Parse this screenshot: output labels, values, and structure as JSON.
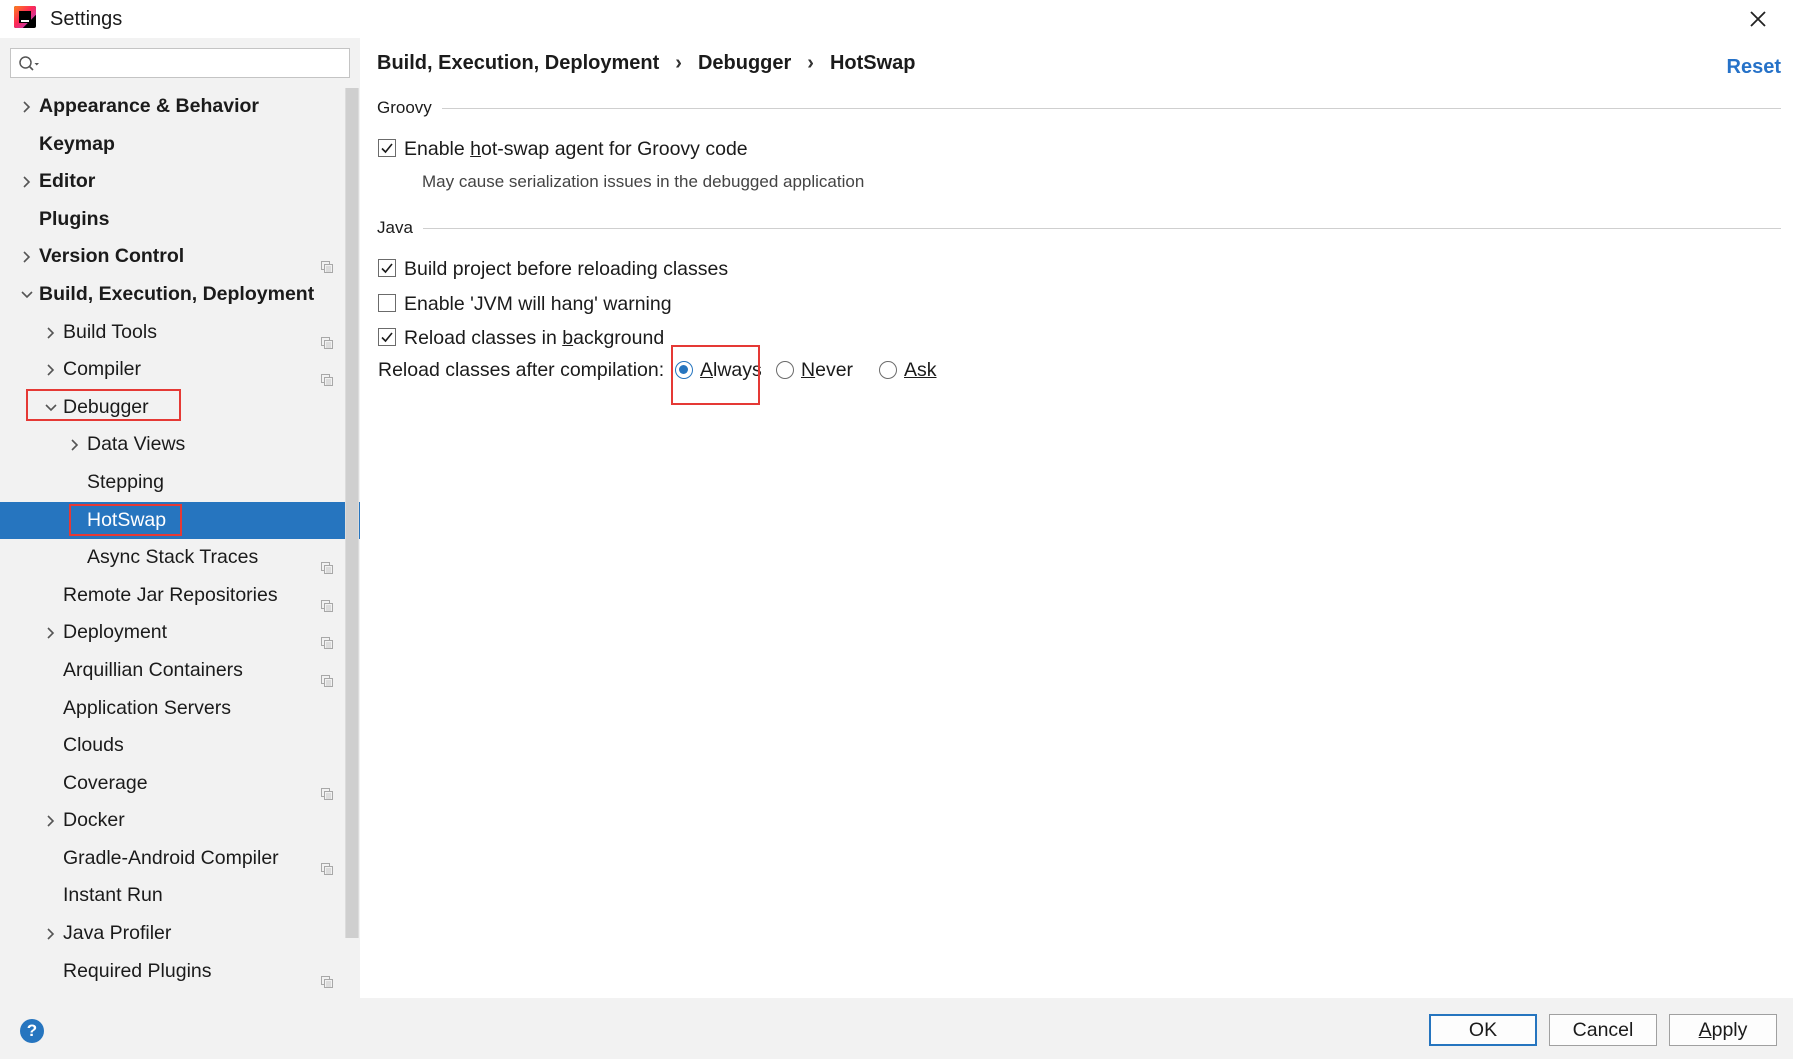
{
  "window": {
    "title": "Settings"
  },
  "search": {
    "placeholder": ""
  },
  "sidebar": {
    "items": [
      {
        "label": "Appearance & Behavior",
        "level": 0,
        "bold": true,
        "chevron": "right",
        "project_icon": false
      },
      {
        "label": "Keymap",
        "level": 0,
        "bold": true,
        "chevron": "none",
        "project_icon": false
      },
      {
        "label": "Editor",
        "level": 0,
        "bold": true,
        "chevron": "right",
        "project_icon": false
      },
      {
        "label": "Plugins",
        "level": 0,
        "bold": true,
        "chevron": "none",
        "project_icon": false
      },
      {
        "label": "Version Control",
        "level": 0,
        "bold": true,
        "chevron": "right",
        "project_icon": true
      },
      {
        "label": "Build, Execution, Deployment",
        "level": 0,
        "bold": true,
        "chevron": "down",
        "project_icon": false
      },
      {
        "label": "Build Tools",
        "level": 1,
        "bold": false,
        "chevron": "right",
        "project_icon": true
      },
      {
        "label": "Compiler",
        "level": 1,
        "bold": false,
        "chevron": "right",
        "project_icon": true
      },
      {
        "label": "Debugger",
        "level": 1,
        "bold": false,
        "chevron": "down",
        "project_icon": false
      },
      {
        "label": "Data Views",
        "level": 2,
        "bold": false,
        "chevron": "right",
        "project_icon": false
      },
      {
        "label": "Stepping",
        "level": 2,
        "bold": false,
        "chevron": "none",
        "project_icon": false
      },
      {
        "label": "HotSwap",
        "level": 2,
        "bold": false,
        "chevron": "none",
        "project_icon": false,
        "selected": true
      },
      {
        "label": "Async Stack Traces",
        "level": 2,
        "bold": false,
        "chevron": "none",
        "project_icon": true
      },
      {
        "label": "Remote Jar Repositories",
        "level": 1,
        "bold": false,
        "chevron": "none",
        "project_icon": true
      },
      {
        "label": "Deployment",
        "level": 1,
        "bold": false,
        "chevron": "right",
        "project_icon": true
      },
      {
        "label": "Arquillian Containers",
        "level": 1,
        "bold": false,
        "chevron": "none",
        "project_icon": true
      },
      {
        "label": "Application Servers",
        "level": 1,
        "bold": false,
        "chevron": "none",
        "project_icon": false
      },
      {
        "label": "Clouds",
        "level": 1,
        "bold": false,
        "chevron": "none",
        "project_icon": false
      },
      {
        "label": "Coverage",
        "level": 1,
        "bold": false,
        "chevron": "none",
        "project_icon": true
      },
      {
        "label": "Docker",
        "level": 1,
        "bold": false,
        "chevron": "right",
        "project_icon": false
      },
      {
        "label": "Gradle-Android Compiler",
        "level": 1,
        "bold": false,
        "chevron": "none",
        "project_icon": true
      },
      {
        "label": "Instant Run",
        "level": 1,
        "bold": false,
        "chevron": "none",
        "project_icon": false
      },
      {
        "label": "Java Profiler",
        "level": 1,
        "bold": false,
        "chevron": "right",
        "project_icon": false
      },
      {
        "label": "Required Plugins",
        "level": 1,
        "bold": false,
        "chevron": "none",
        "project_icon": true
      }
    ]
  },
  "breadcrumb": [
    "Build, Execution, Deployment",
    "Debugger",
    "HotSwap"
  ],
  "breadcrumb_separator": "›",
  "reset_label": "Reset",
  "groovy": {
    "title": "Groovy",
    "enable_agent": {
      "pre": "Enable ",
      "mnemonic": "h",
      "post": "ot-swap agent for Groovy code",
      "checked": true
    },
    "hint": "May cause serialization issues in the debugged application"
  },
  "java": {
    "title": "Java",
    "build_before": {
      "pre": "",
      "mnemonic": "",
      "post": "Build project before reloading classes",
      "checked": true
    },
    "jvm_hang": {
      "pre": "",
      "mnemonic": "",
      "post": "Enable 'JVM will hang' warning",
      "checked": false
    },
    "reload_bg": {
      "pre": "Reload classes in ",
      "mnemonic": "b",
      "post": "ackground",
      "checked": true
    },
    "reload_after": {
      "prompt": "Reload classes after compilation:",
      "options": [
        {
          "mnemonic": "A",
          "rest": "lways",
          "selected": true
        },
        {
          "mnemonic": "N",
          "rest": "ever",
          "selected": false
        },
        {
          "mnemonic": "",
          "rest": "Ask",
          "selected": false
        }
      ]
    }
  },
  "footer": {
    "help": "?",
    "ok": "OK",
    "cancel": "Cancel",
    "apply_mnemonic": "A",
    "apply_rest": "pply"
  },
  "colors": {
    "selection": "#2675bf",
    "link": "#2672c8",
    "highlight_box": "#e53935"
  }
}
